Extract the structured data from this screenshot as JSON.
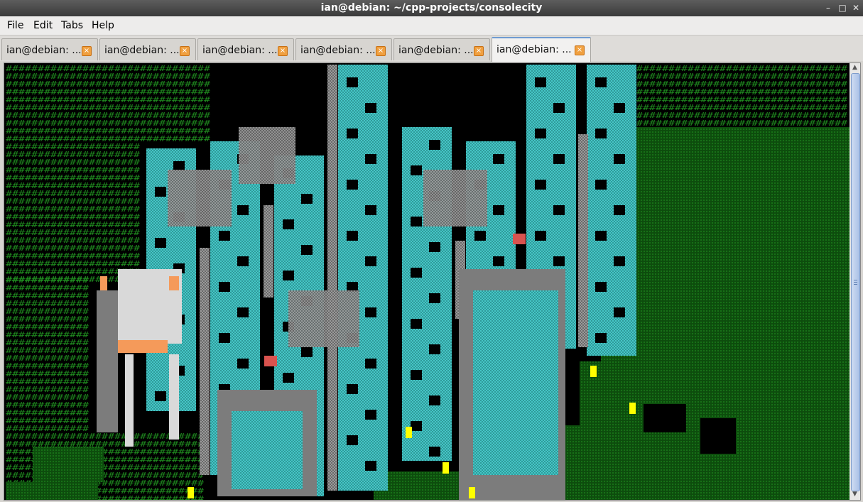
{
  "window": {
    "title": "ian@debian: ~/cpp-projects/consolecity",
    "min_icon": "minimize-icon",
    "max_icon": "maximize-icon",
    "close_icon": "close-icon"
  },
  "menu": [
    {
      "label": "File"
    },
    {
      "label": "Edit"
    },
    {
      "label": "Tabs"
    },
    {
      "label": "Help"
    }
  ],
  "tabs": [
    {
      "label": "ian@debian: ...",
      "active": false
    },
    {
      "label": "ian@debian: ...",
      "active": false
    },
    {
      "label": "ian@debian: ...",
      "active": false
    },
    {
      "label": "ian@debian: ...",
      "active": false
    },
    {
      "label": "ian@debian: ...",
      "active": false
    },
    {
      "label": "ian@debian: ...",
      "active": true
    }
  ],
  "terminal": {
    "glyph": "#",
    "colors": {
      "background": "#000000",
      "grass": "#1f8c1f",
      "forest": "#0d4d0d",
      "cyan": "#46c6c6",
      "gray": "#7c7c7c",
      "darkgray": "#3a3a3a",
      "light": "#d9d9d9",
      "red": "#d9534f",
      "yellow": "#ffff00",
      "orange": "#f59a5a"
    }
  }
}
